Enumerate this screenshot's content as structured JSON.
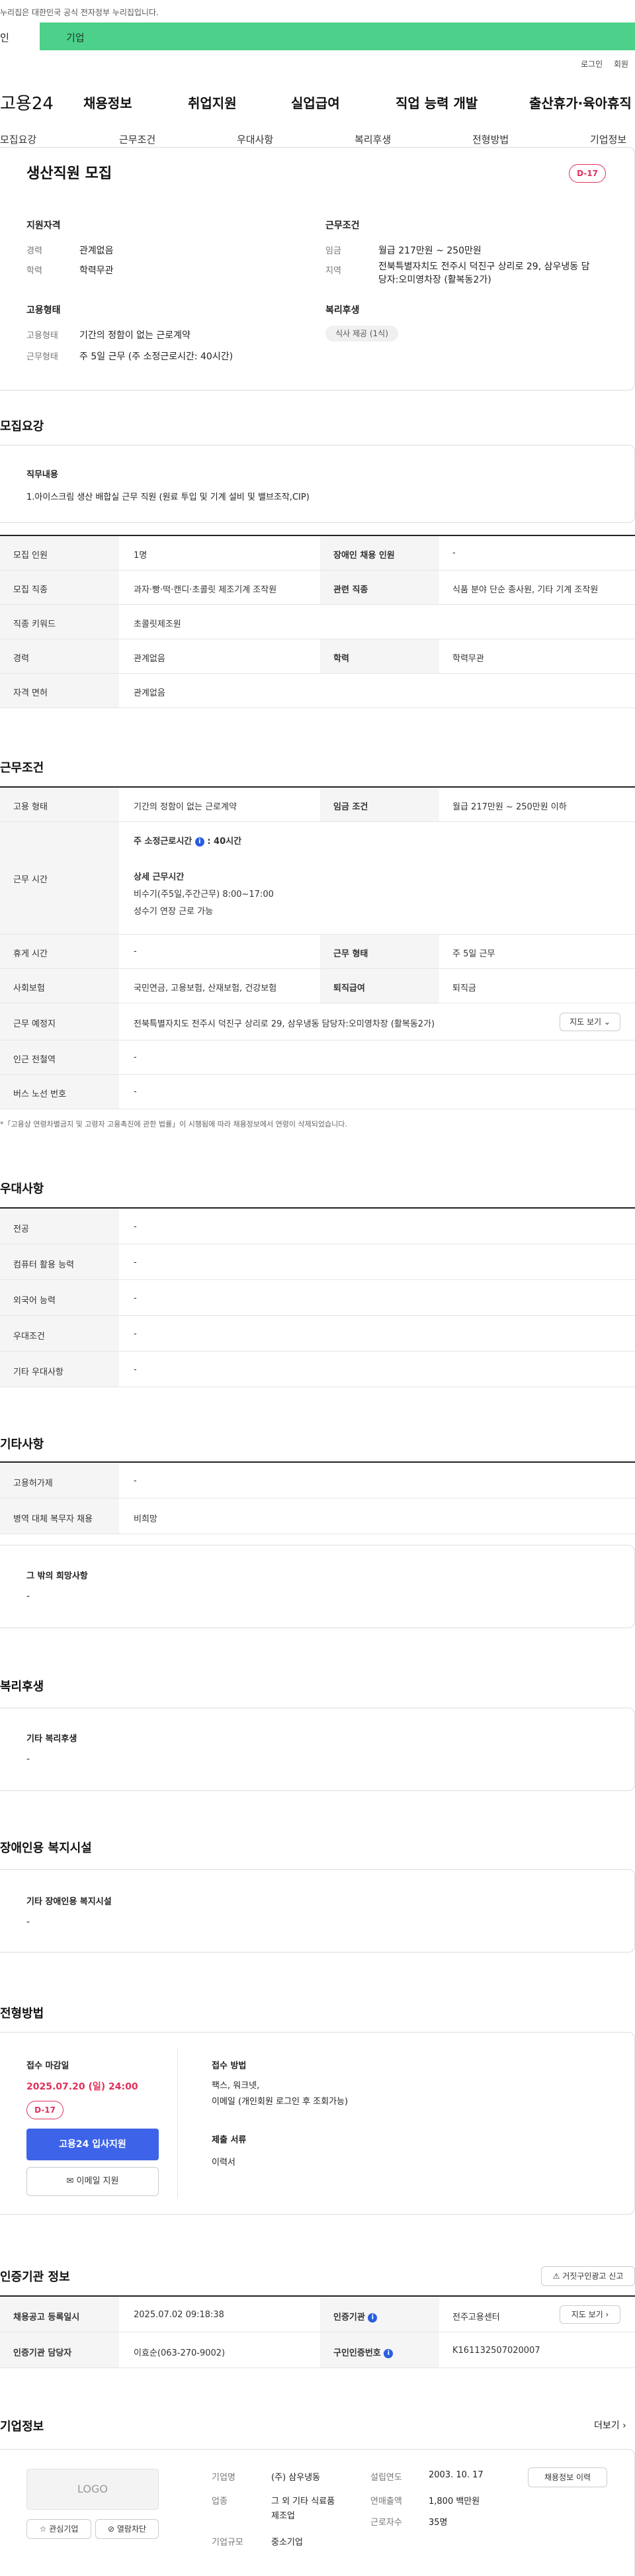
{
  "top_notice": "누리집은 대한민국 공식 전자정부 누리집입니다.",
  "top_tabs": {
    "personal": "인",
    "company": "기업"
  },
  "util": {
    "login": "로그인",
    "join": "회원"
  },
  "logo": "고용24",
  "main_nav": [
    "채용정보",
    "취업지원",
    "실업급여",
    "직업 능력 개발",
    "출산휴가·육아휴직"
  ],
  "sub_nav": [
    "모집요강",
    "근무조건",
    "우대사항",
    "복리후생",
    "전형방법",
    "기업정보"
  ],
  "job": {
    "title": "생산직원 모집",
    "dday": "D-17",
    "qual_title": "지원자격",
    "career_k": "경력",
    "career_v": "관계없음",
    "edu_k": "학력",
    "edu_v": "학력무관",
    "emp_title": "고용형태",
    "emptype_k": "고용형태",
    "emptype_v": "기간의 정함이 없는 근로계약",
    "hours_k": "근무형태",
    "hours_v": "주 5일 근무 (주 소정근로시간: 40시간)",
    "cond_title": "근무조건",
    "wage_k": "임금",
    "wage_v": "월급 217만원 ~ 250만원",
    "loc_k": "지역",
    "loc_v1": "전북특별자치도 전주시 덕진구 상리로 29, 삼우냉동 담",
    "loc_v2": "당자:오미영차장 (활복동2가)",
    "welfare_title": "복리후생",
    "welfare_pill": "식사 제공 (1식)"
  },
  "recruit": {
    "title": "모집요강",
    "duty_k": "직무내용",
    "duty_v": "1.아이스크림 생산 배합실 근무 직원 (원료 투입 및 기계 설비 및 밸브조작,CIP)",
    "rows": [
      {
        "k1": "모집 인원",
        "v1": "1명",
        "k2": "장애인 채용 인원",
        "v2": "-"
      },
      {
        "k1": "모집 직종",
        "v1": "과자·빵·떡·캔디·초콜릿 제조기계 조작원",
        "k2": "관련 직종",
        "v2": "식품 분야 단순 종사원, 기타 기계 조작원"
      },
      {
        "k1": "직종 키워드",
        "v1": "초콜릿제조원"
      },
      {
        "k1": "경력",
        "v1": "관계없음",
        "k2": "학력",
        "v2": "학력무관"
      },
      {
        "k1": "자격 면허",
        "v1": "관계없음"
      }
    ]
  },
  "work": {
    "title": "근무조건",
    "emptype_k": "고용 형태",
    "emptype_v": "기간의 정함이 없는 근로계약",
    "wage_k": "임금 조건",
    "wage_v": "월급 217만원 ~ 250만원 이하",
    "time_k": "근무 시간",
    "time_l1": "주 소정근로시간",
    "time_l1b": ": 40시간",
    "time_l2": "상세 근무시간",
    "time_l3": "비수기(주5일,주간근무) 8:00~17:00",
    "time_l4": "성수기 연장 근로 가능",
    "rest_k": "휴게 시간",
    "rest_v": "-",
    "form_k": "근무 형태",
    "form_v": "주 5일 근무",
    "ins_k": "사회보험",
    "ins_v": "국민연금, 고용보험, 산재보험, 건강보험",
    "ret_k": "퇴직급여",
    "ret_v": "퇴직금",
    "place_k": "근무 예정지",
    "place_v": "전북특별자치도 전주시 덕진구 상리로 29, 삼우냉동 담당자:오미영차장 (활복동2가)",
    "map_btn": "지도 보기",
    "sub_k": "인근 전철역",
    "sub_v": "-",
    "bus_k": "버스 노선 번호",
    "bus_v": "-",
    "note": "*「고용상 연령차별금지 및 고령자 고용촉진에 관한 법률」이 시행됨에 따라 채용정보에서 연령이 삭제되었습니다."
  },
  "pref": {
    "title": "우대사항",
    "rows": [
      [
        "전공",
        "-"
      ],
      [
        "컴퓨터 활용 능력",
        "-"
      ],
      [
        "외국어 능력",
        "-"
      ],
      [
        "우대조건",
        "-"
      ],
      [
        "기타 우대사항",
        "-"
      ]
    ]
  },
  "etc": {
    "title": "기타사항",
    "rows": [
      [
        "고용허가제",
        "-"
      ],
      [
        "병역 대체 복무자 채용",
        "비희망"
      ]
    ],
    "wish_k": "그 밖의 희망사항",
    "wish_v": "-"
  },
  "welfare": {
    "title": "복리후생",
    "k": "기타 복리후생",
    "v": "-"
  },
  "disab": {
    "title": "장애인용 복지시설",
    "k": "기타 장애인용 복지시설",
    "v": "-"
  },
  "select": {
    "title": "전형방법",
    "deadline_k": "접수 마감일",
    "deadline_v": "2025.07.20 (일) 24:00",
    "dday": "D-17",
    "apply_btn": "고용24 입사지원",
    "email_btn": "이메일 지원",
    "method_k": "접수 방법",
    "method_v1": "팩스, 워크넷,",
    "method_v2": "이메일 (개인회원 로그인 후 조회가능)",
    "doc_k": "제출 서류",
    "doc_v": "이력서"
  },
  "cert": {
    "title": "인증기관 정보",
    "report_btn": "거짓구인광고 신고",
    "reg_k": "채용공고 등록일시",
    "reg_v": "2025.07.02 09:18:38",
    "agency_k": "인증기관",
    "agency_v": "전주고용센터",
    "map_btn": "지도 보기",
    "mgr_k": "인증기관 담당자",
    "mgr_v": "이효순(063-270-9002)",
    "num_k": "구인인증번호",
    "num_v": "K161132507020007"
  },
  "company": {
    "title": "기업정보",
    "more": "더보기",
    "logo": "LOGO",
    "fav_btn": "관심기업",
    "block_btn": "열람차단",
    "name_k": "기업명",
    "name_v": "(주) 삼우냉동",
    "ind_k": "업종",
    "ind_v1": "그 외 기타 식료품",
    "ind_v2": "제조업",
    "size_k": "기업규모",
    "size_v": "중소기업",
    "est_k": "설립연도",
    "est_v": "2003. 10. 17",
    "sales_k": "연매출액",
    "sales_v": "1,800 백만원",
    "emp_k": "근로자수",
    "emp_v": "35명",
    "hist_btn": "채용정보 이력"
  },
  "colors": {
    "green": "#4cd08a",
    "blue": "#3d64e8",
    "red": "#e0305a"
  }
}
